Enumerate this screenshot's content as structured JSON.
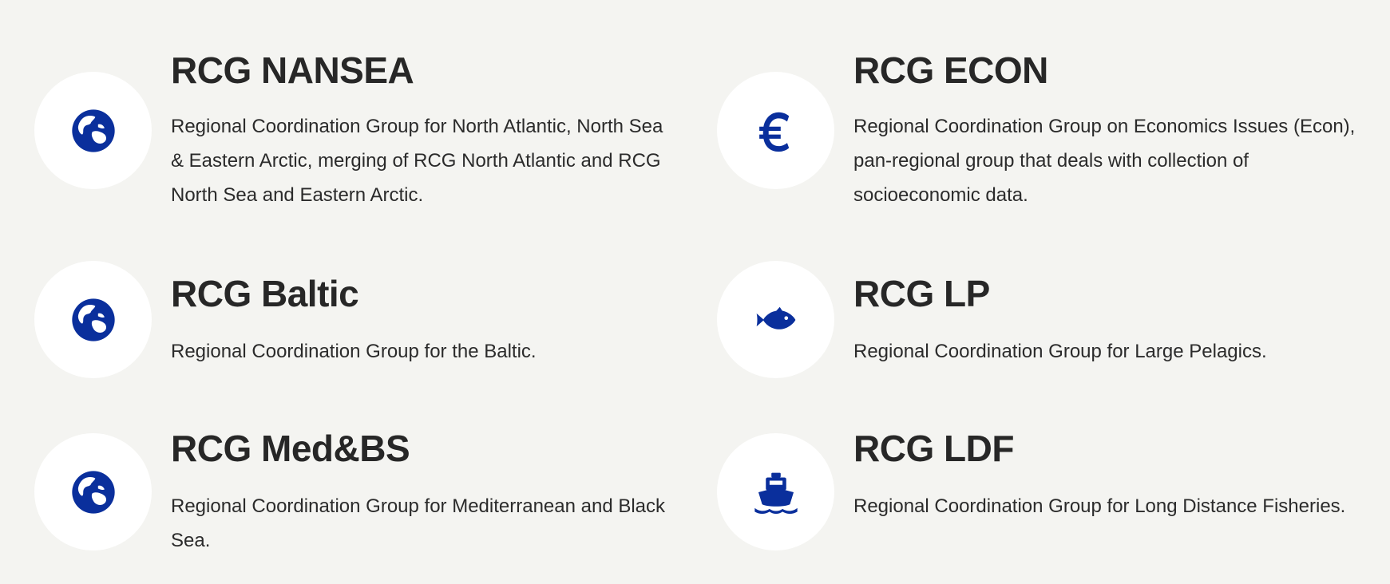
{
  "colors": {
    "background": "#f4f4f1",
    "icon_circle": "#ffffff",
    "icon_accent": "#0a2f9c",
    "text": "#272727"
  },
  "groups": [
    {
      "icon": "globe-icon",
      "title": "RCG NANSEA",
      "description": "Regional Coordination Group for North Atlantic, North Sea & Eastern Arctic, merging of RCG North Atlantic and RCG North Sea and Eastern Arctic."
    },
    {
      "icon": "euro-icon",
      "title": "RCG ECON",
      "description": "Regional Coordination Group on Economics Issues (Econ), pan-regional group that deals with collection of socioeconomic data."
    },
    {
      "icon": "globe-icon",
      "title": "RCG Baltic",
      "description": "Regional Coordination Group for the Baltic."
    },
    {
      "icon": "fish-icon",
      "title": "RCG LP",
      "description": "Regional Coordination Group for Large Pelagics."
    },
    {
      "icon": "globe-icon",
      "title": "RCG Med&BS",
      "description": "Regional Coordination Group for Mediterranean and Black Sea."
    },
    {
      "icon": "ship-icon",
      "title": "RCG LDF",
      "description": "Regional Coordination Group for Long Distance Fisheries."
    }
  ]
}
